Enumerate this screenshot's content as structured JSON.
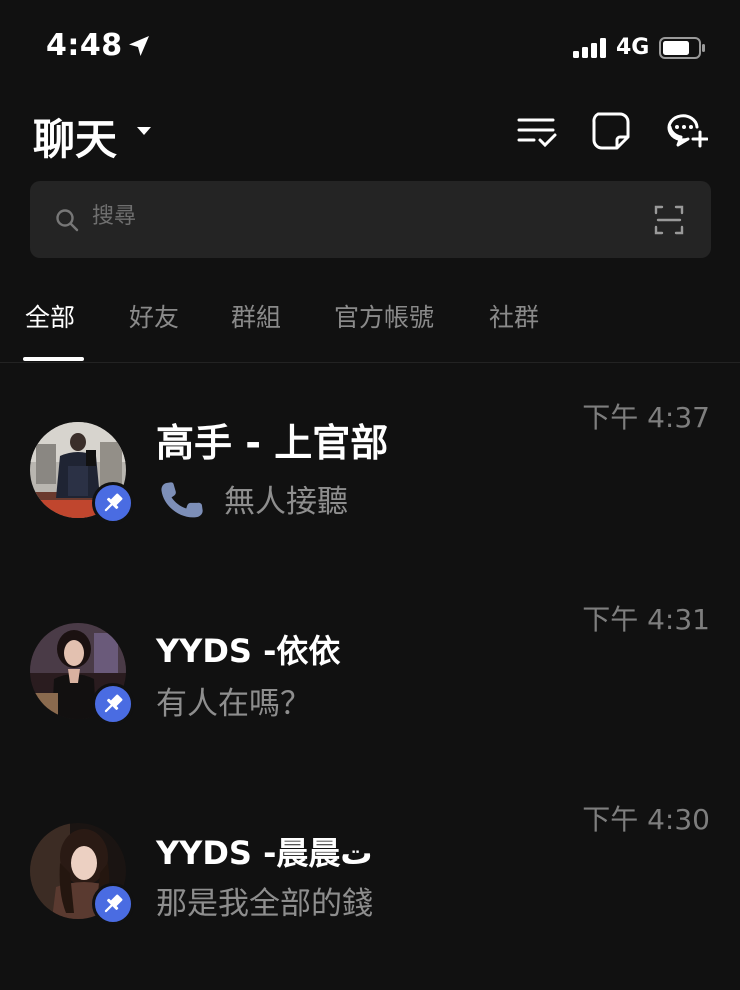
{
  "status_bar": {
    "time": "4:48",
    "network": "4G",
    "location_icon": "location-arrow-icon",
    "signal_icon": "cellular-signal-icon",
    "battery_icon": "battery-icon"
  },
  "header": {
    "title": "聊天",
    "dropdown_icon": "caret-down-icon",
    "actions": [
      {
        "icon": "edit-list-icon"
      },
      {
        "icon": "note-icon"
      },
      {
        "icon": "new-chat-icon"
      }
    ]
  },
  "search": {
    "placeholder": "搜尋",
    "value": "",
    "icon": "search-icon",
    "scan_icon": "qr-scan-icon"
  },
  "tabs": [
    {
      "label": "全部",
      "active": true
    },
    {
      "label": "好友",
      "active": false
    },
    {
      "label": "群組",
      "active": false
    },
    {
      "label": "官方帳號",
      "active": false
    },
    {
      "label": "社群",
      "active": false
    }
  ],
  "chats": [
    {
      "name": "高手 - 上官部",
      "message": "無人接聽",
      "message_icon": "phone-icon",
      "time": "下午 4:37",
      "pinned": true,
      "avatar_icon": "avatar-photo"
    },
    {
      "name": "YYDS -依依",
      "message": "有人在嗎？",
      "time": "下午 4:31",
      "pinned": true,
      "avatar_icon": "avatar-photo"
    },
    {
      "name": "YYDS -晨晨ت",
      "message": "那是我全部的錢",
      "time": "下午 4:30",
      "pinned": true,
      "avatar_icon": "avatar-photo"
    }
  ],
  "colors": {
    "background": "#111111",
    "search_bg": "#242424",
    "pin_badge": "#4a6ce2",
    "muted_text": "#8e8e8e",
    "time_text": "#7e7e7e"
  }
}
